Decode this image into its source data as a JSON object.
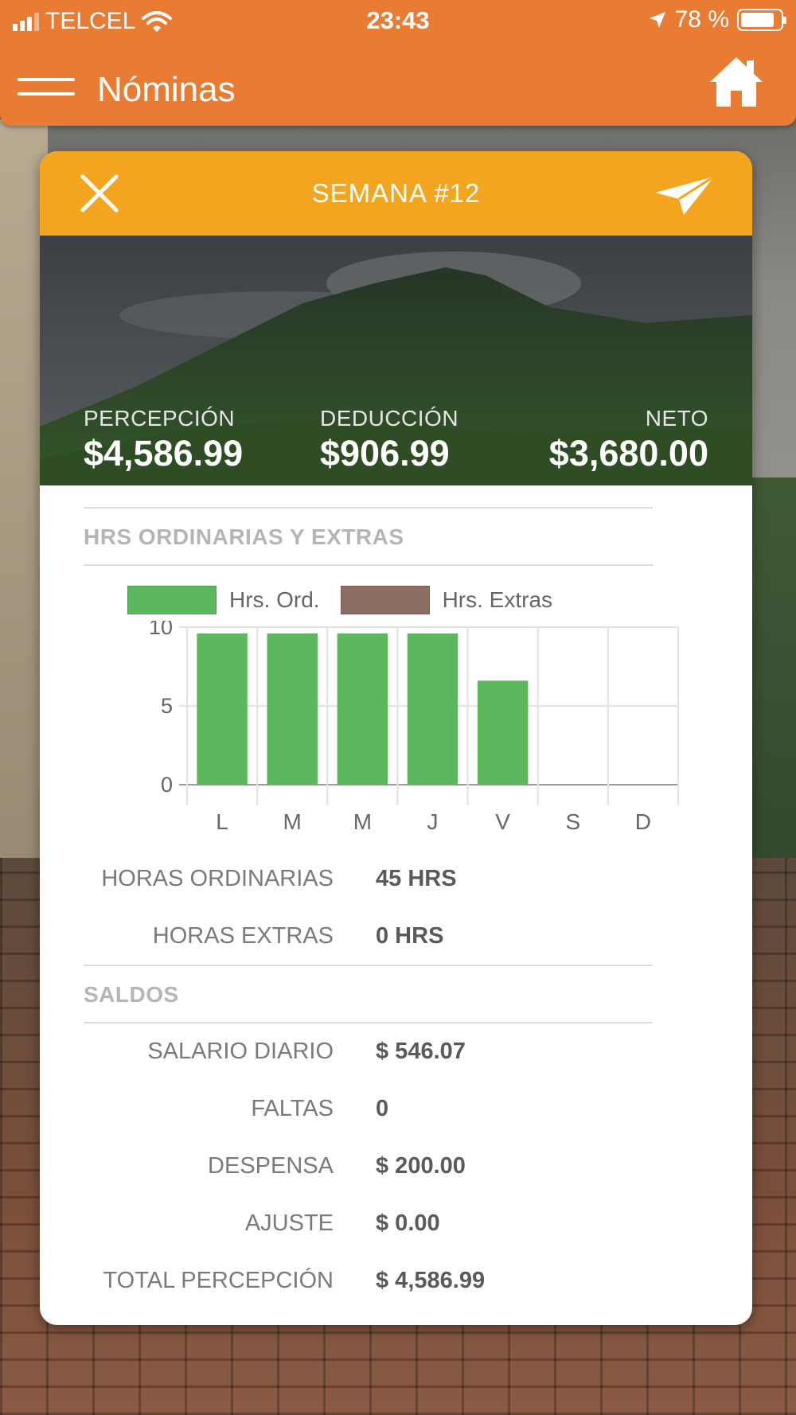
{
  "status_bar": {
    "carrier": "TELCEL",
    "time": "23:43",
    "battery": "78 %"
  },
  "header": {
    "title": "Nóminas"
  },
  "card": {
    "title": "SEMANA #12",
    "totals": [
      {
        "label": "PERCEPCIÓN",
        "value": "$4,586.99"
      },
      {
        "label": "DEDUCCIÓN",
        "value": "$906.99"
      },
      {
        "label": "NETO",
        "value": "$3,680.00"
      }
    ],
    "hours_section_title": "HRS ORDINARIAS Y EXTRAS",
    "hours_rows": [
      {
        "label": "HORAS ORDINARIAS",
        "value": "45 HRS"
      },
      {
        "label": "HORAS EXTRAS",
        "value": "0 HRS"
      }
    ],
    "balances_section_title": "SALDOS",
    "balances_rows": [
      {
        "label": "SALARIO DIARIO",
        "value": "$ 546.07"
      },
      {
        "label": "FALTAS",
        "value": "0"
      },
      {
        "label": "DESPENSA",
        "value": "$ 200.00"
      },
      {
        "label": "AJUSTE",
        "value": "$ 0.00"
      },
      {
        "label": "TOTAL PERCEPCIÓN",
        "value": "$ 4,586.99"
      }
    ]
  },
  "colors": {
    "header": "#ea7b33",
    "card_header": "#f4a51f",
    "ord_bar": "#5cb85c",
    "extra_bar": "#8d6e63"
  },
  "icons": {
    "menu": "hamburger-icon",
    "home": "home-icon",
    "close": "close-icon",
    "send": "paper-plane-icon"
  },
  "chart_data": {
    "type": "bar",
    "categories": [
      "L",
      "M",
      "M",
      "J",
      "V",
      "S",
      "D"
    ],
    "series": [
      {
        "name": "Hrs. Ord.",
        "values": [
          9.6,
          9.6,
          9.6,
          9.6,
          6.6,
          0,
          0
        ],
        "color": "#5cb85c"
      },
      {
        "name": "Hrs. Extras",
        "values": [
          0,
          0,
          0,
          0,
          0,
          0,
          0
        ],
        "color": "#8d6e63"
      }
    ],
    "yticks": [
      0,
      5,
      10
    ],
    "ylim": [
      0,
      10
    ],
    "grid": true,
    "legend": "top"
  }
}
